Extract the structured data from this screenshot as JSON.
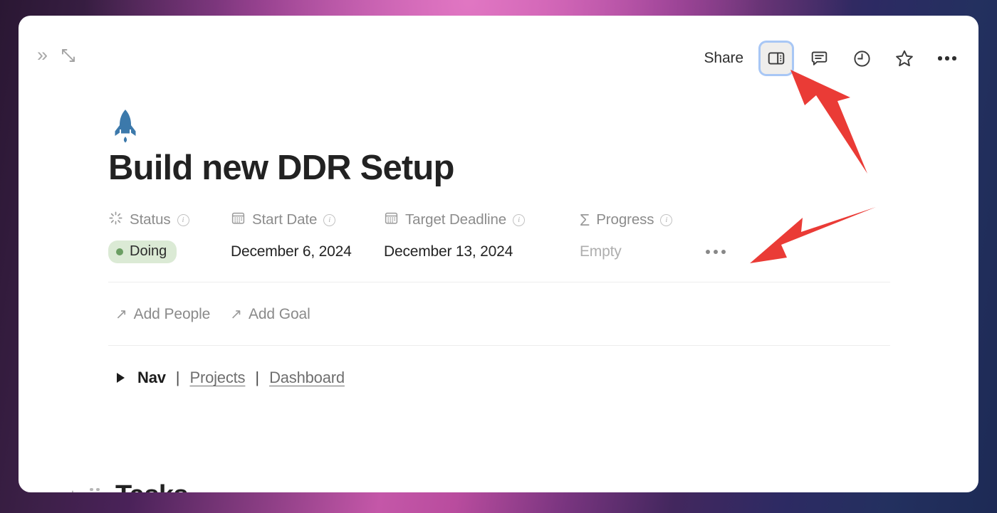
{
  "window": {
    "topbar": {
      "collapse_sidebar_icon": "double-chevron-right-icon",
      "expand_icon": "expand-diagonal-icon",
      "share_label": "Share",
      "sidepeek_icon": "sidebar-panel-icon",
      "comment_icon": "comment-bubble-icon",
      "history_icon": "clock-history-icon",
      "favorite_icon": "star-icon",
      "more_icon": "more-horizontal-icon"
    }
  },
  "page": {
    "emoji": "rocket-emoji",
    "title": "Build new DDR Setup",
    "properties": [
      {
        "icon": "status-spinner-icon",
        "label": "Status",
        "value": "Doing",
        "type": "status",
        "pill_bg": "#dbead5",
        "dot_color": "#6b9e63"
      },
      {
        "icon": "calendar-icon",
        "label": "Start Date",
        "value": "December 6, 2024",
        "type": "date"
      },
      {
        "icon": "calendar-icon",
        "label": "Target Deadline",
        "value": "December 13, 2024",
        "type": "date"
      },
      {
        "icon": "sigma-rollup-icon",
        "label": "Progress",
        "value": "Empty",
        "type": "rollup",
        "empty": true
      }
    ],
    "property_more_label": "•••",
    "relations": [
      {
        "icon": "arrow-up-right-icon",
        "label": "Add People"
      },
      {
        "icon": "arrow-up-right-icon",
        "label": "Add Goal"
      }
    ],
    "nav": {
      "toggle_icon": "triangle-right-icon",
      "label": "Nav",
      "separator": "|",
      "links": [
        "Projects",
        "Dashboard"
      ]
    },
    "tasks": {
      "add_icon": "plus-icon",
      "drag_icon": "drag-handle-icon",
      "heading": "Tasks"
    }
  },
  "annotations": {
    "accent_color": "#ea3b36",
    "arrow_to_sidepeek": "arrow-pointing-up-left",
    "arrow_to_property_menu": "arrow-pointing-down-left"
  }
}
